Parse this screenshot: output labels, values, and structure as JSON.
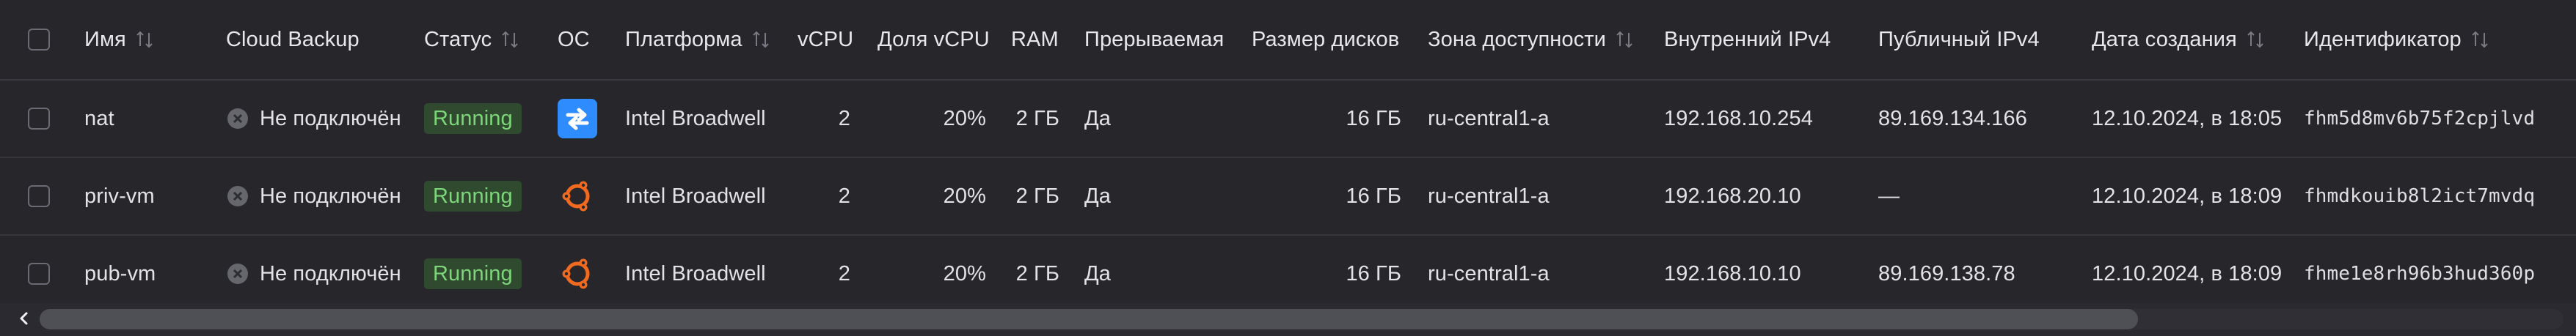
{
  "table": {
    "headers": {
      "name": "Имя",
      "cloud_backup": "Cloud Backup",
      "status": "Статус",
      "os": "ОС",
      "platform": "Платформа",
      "vcpu": "vCPU",
      "vcpu_share": "Доля vCPU",
      "ram": "RAM",
      "preemptible": "Прерываемая",
      "disk_size": "Размер дисков",
      "zone": "Зона доступности",
      "internal_ipv4": "Внутренний IPv4",
      "public_ipv4": "Публичный IPv4",
      "created_at": "Дата создания",
      "id": "Идентификатор"
    },
    "rows": [
      {
        "name": "nat",
        "cloud_backup": "Не подключён",
        "status": "Running",
        "os_icon": "nat-instance-icon",
        "platform": "Intel Broadwell",
        "vcpu": "2",
        "vcpu_share": "20%",
        "ram": "2 ГБ",
        "preemptible": "Да",
        "disk_size": "16 ГБ",
        "zone": "ru-central1-a",
        "internal_ipv4": "192.168.10.254",
        "public_ipv4": "89.169.134.166",
        "created_at": "12.10.2024, в 18:05",
        "id": "fhm5d8mv6b75f2cpjlvd"
      },
      {
        "name": "priv-vm",
        "cloud_backup": "Не подключён",
        "status": "Running",
        "os_icon": "ubuntu-icon",
        "platform": "Intel Broadwell",
        "vcpu": "2",
        "vcpu_share": "20%",
        "ram": "2 ГБ",
        "preemptible": "Да",
        "disk_size": "16 ГБ",
        "zone": "ru-central1-a",
        "internal_ipv4": "192.168.20.10",
        "public_ipv4": "—",
        "created_at": "12.10.2024, в 18:09",
        "id": "fhmdkouib8l2ict7mvdq"
      },
      {
        "name": "pub-vm",
        "cloud_backup": "Не подключён",
        "status": "Running",
        "os_icon": "ubuntu-icon",
        "platform": "Intel Broadwell",
        "vcpu": "2",
        "vcpu_share": "20%",
        "ram": "2 ГБ",
        "preemptible": "Да",
        "disk_size": "16 ГБ",
        "zone": "ru-central1-a",
        "internal_ipv4": "192.168.10.10",
        "public_ipv4": "89.169.138.78",
        "created_at": "12.10.2024, в 18:09",
        "id": "fhme1e8rh96b3hud360p"
      }
    ]
  },
  "scrollbar": {
    "direction_icon": "chevron-left-icon",
    "visible_fraction": 0.83
  },
  "colors": {
    "background": "#26262b",
    "running_badge_bg": "#2f4a2f",
    "running_badge_text": "#7ed67a",
    "nat_icon": "#2f8cff",
    "ubuntu_icon": "#f06a1f"
  }
}
